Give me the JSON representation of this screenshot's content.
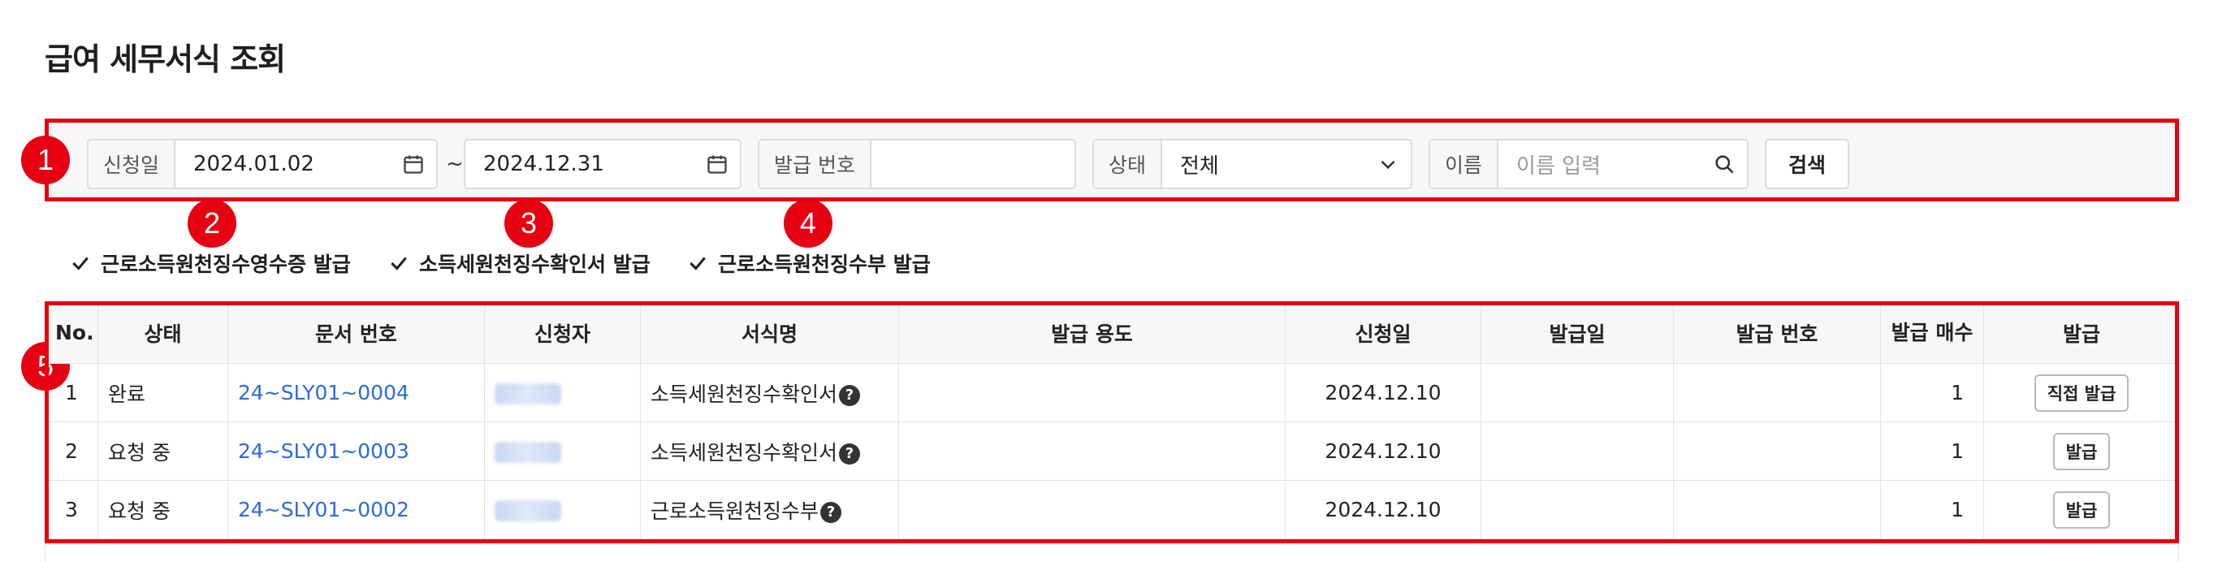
{
  "page": {
    "title": "급여 세무서식 조회"
  },
  "search": {
    "date_label": "신청일",
    "date_from": "2024.01.02",
    "date_to": "2024.12.31",
    "date_separator": "~",
    "issue_no_label": "발급 번호",
    "issue_no_value": "",
    "status_label": "상태",
    "status_value": "전체",
    "name_label": "이름",
    "name_placeholder": "이름 입력",
    "search_button": "검색"
  },
  "markers": [
    "1",
    "2",
    "3",
    "4",
    "5"
  ],
  "actions": [
    {
      "label": "근로소득원천징수영수증 발급"
    },
    {
      "label": "소득세원천징수확인서 발급"
    },
    {
      "label": "근로소득원천징수부 발급"
    }
  ],
  "table": {
    "headers": [
      "No.",
      "상태",
      "문서 번호",
      "신청자",
      "서식명",
      "발급 용도",
      "신청일",
      "발급일",
      "발급 번호",
      "발급 매수",
      "발급"
    ],
    "rows": [
      {
        "no": "1",
        "status": "완료",
        "doc_no": "24~SLY01~0004",
        "form": "소득세원천징수확인서",
        "purpose": "",
        "apply_date": "2024.12.10",
        "issue_date": "",
        "issue_no": "",
        "count": "1",
        "action": "직접 발급"
      },
      {
        "no": "2",
        "status": "요청 중",
        "doc_no": "24~SLY01~0003",
        "form": "소득세원천징수확인서",
        "purpose": "",
        "apply_date": "2024.12.10",
        "issue_date": "",
        "issue_no": "",
        "count": "1",
        "action": "발급"
      },
      {
        "no": "3",
        "status": "요청 중",
        "doc_no": "24~SLY01~0002",
        "form": "근로소득원천징수부",
        "purpose": "",
        "apply_date": "2024.12.10",
        "issue_date": "",
        "issue_no": "",
        "count": "1",
        "action": "발급"
      }
    ]
  },
  "icons": {
    "help": "?",
    "calendar": "calendar-icon",
    "chevron": "chevron-down-icon",
    "search": "search-icon",
    "check": "check-icon"
  },
  "colors": {
    "highlight": "#e60012",
    "link": "#2b6cd4"
  }
}
